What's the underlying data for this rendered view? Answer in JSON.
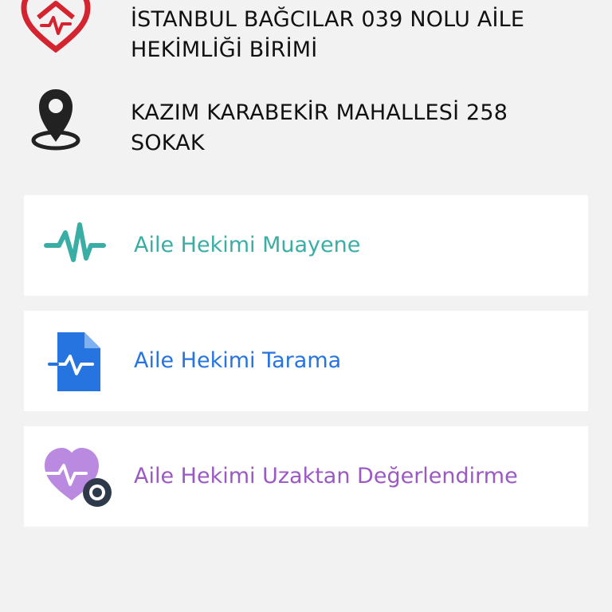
{
  "clinic": {
    "name": "İSTANBUL BAĞCILAR 039 NOLU AİLE HEKİMLİĞİ BİRİMİ",
    "address": "KAZIM KARABEKİR MAHALLESİ 258 SOKAK"
  },
  "icons": {
    "logo": "heart-house-logo-icon",
    "location": "location-pin-icon",
    "muayene": "heartbeat-pulse-icon",
    "tarama": "medical-document-icon",
    "uzaktan": "heart-camera-icon"
  },
  "colors": {
    "background": "#f2f2f2",
    "logo_red": "#d3242f",
    "teal": "#3aaea5",
    "blue": "#2574e0",
    "purple": "#9b59c4"
  },
  "services": [
    {
      "label": "Aile Hekimi Muayene",
      "color": "#3aaea5"
    },
    {
      "label": "Aile Hekimi Tarama",
      "color": "#2574e0"
    },
    {
      "label": "Aile Hekimi Uzaktan Değerlendirme",
      "color": "#9b59c4"
    }
  ]
}
